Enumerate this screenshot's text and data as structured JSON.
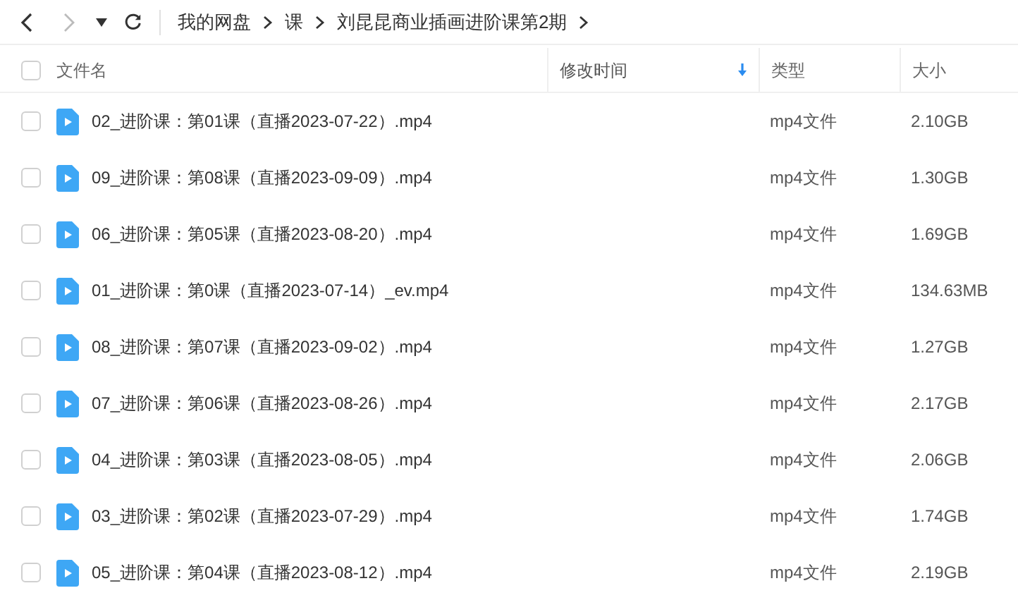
{
  "toolbar": {
    "breadcrumbs": [
      "我的网盘",
      "课",
      "刘昆昆商业插画进阶课第2期"
    ]
  },
  "table": {
    "columns": [
      {
        "label": "文件名",
        "sorted": false
      },
      {
        "label": "修改时间",
        "sorted": true
      },
      {
        "label": "类型",
        "sorted": false
      },
      {
        "label": "大小",
        "sorted": false
      }
    ],
    "header_checked": false,
    "rows": [
      {
        "name": "02_进阶课：第01课（直播2023-07-22）.mp4",
        "type": "mp4文件",
        "size": "2.10GB",
        "checked": false
      },
      {
        "name": "09_进阶课：第08课（直播2023-09-09）.mp4",
        "type": "mp4文件",
        "size": "1.30GB",
        "checked": false
      },
      {
        "name": "06_进阶课：第05课（直播2023-08-20）.mp4",
        "type": "mp4文件",
        "size": "1.69GB",
        "checked": false
      },
      {
        "name": "01_进阶课：第0课（直播2023-07-14）_ev.mp4",
        "type": "mp4文件",
        "size": "134.63MB",
        "checked": false
      },
      {
        "name": "08_进阶课：第07课（直播2023-09-02）.mp4",
        "type": "mp4文件",
        "size": "1.27GB",
        "checked": false
      },
      {
        "name": "07_进阶课：第06课（直播2023-08-26）.mp4",
        "type": "mp4文件",
        "size": "2.17GB",
        "checked": false
      },
      {
        "name": "04_进阶课：第03课（直播2023-08-05）.mp4",
        "type": "mp4文件",
        "size": "2.06GB",
        "checked": false
      },
      {
        "name": "03_进阶课：第02课（直播2023-07-29）.mp4",
        "type": "mp4文件",
        "size": "1.74GB",
        "checked": false
      },
      {
        "name": "05_进阶课：第04课（直播2023-08-12）.mp4",
        "type": "mp4文件",
        "size": "2.19GB",
        "checked": false
      }
    ]
  }
}
